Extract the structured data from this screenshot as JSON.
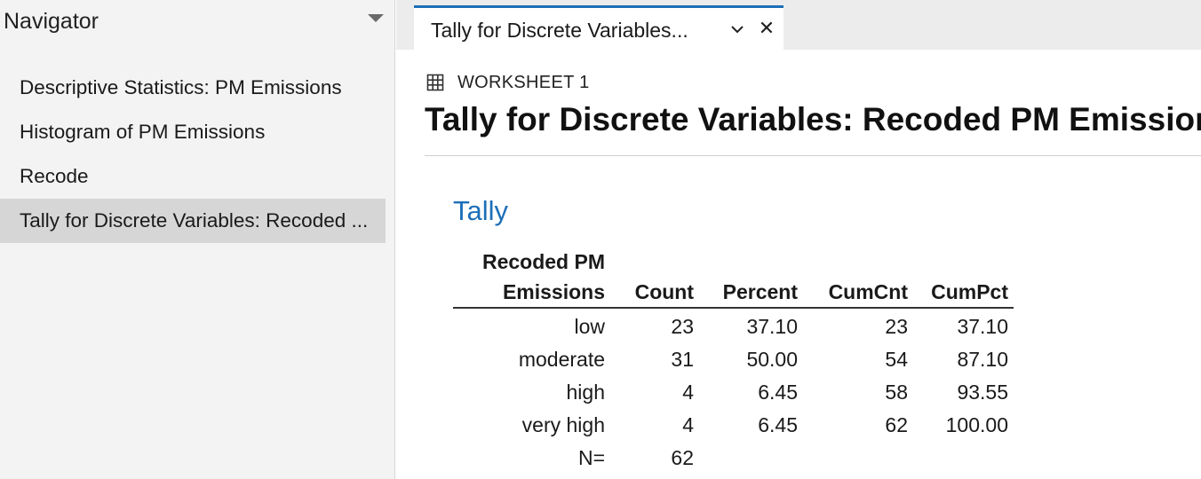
{
  "navigator": {
    "title": "Navigator",
    "items": [
      {
        "label": "Descriptive Statistics: PM Emissions"
      },
      {
        "label": "Histogram of PM Emissions"
      },
      {
        "label": "Recode"
      },
      {
        "label": "Tally for Discrete Variables: Recoded ..."
      }
    ],
    "selected_index": 3
  },
  "tab": {
    "label": "Tally for Discrete Variables..."
  },
  "worksheet": {
    "label": "WORKSHEET 1"
  },
  "page_title": "Tally for Discrete Variables: Recoded PM Emissions",
  "section_title": "Tally",
  "table": {
    "headers": {
      "variable_line1": "Recoded PM",
      "variable_line2": "Emissions",
      "count": "Count",
      "percent": "Percent",
      "cumcnt": "CumCnt",
      "cumpct": "CumPct"
    },
    "rows": [
      [
        "low",
        "23",
        "37.10",
        "23",
        "37.10"
      ],
      [
        "moderate",
        "31",
        "50.00",
        "54",
        "87.10"
      ],
      [
        "high",
        "4",
        "6.45",
        "58",
        "93.55"
      ],
      [
        "very high",
        "4",
        "6.45",
        "62",
        "100.00"
      ]
    ],
    "total": {
      "label": "N=",
      "count": "62"
    }
  },
  "colors": {
    "accent": "#1d6fb8",
    "nav_bg": "#f3f3f3",
    "nav_selected": "#d6d6d6"
  }
}
